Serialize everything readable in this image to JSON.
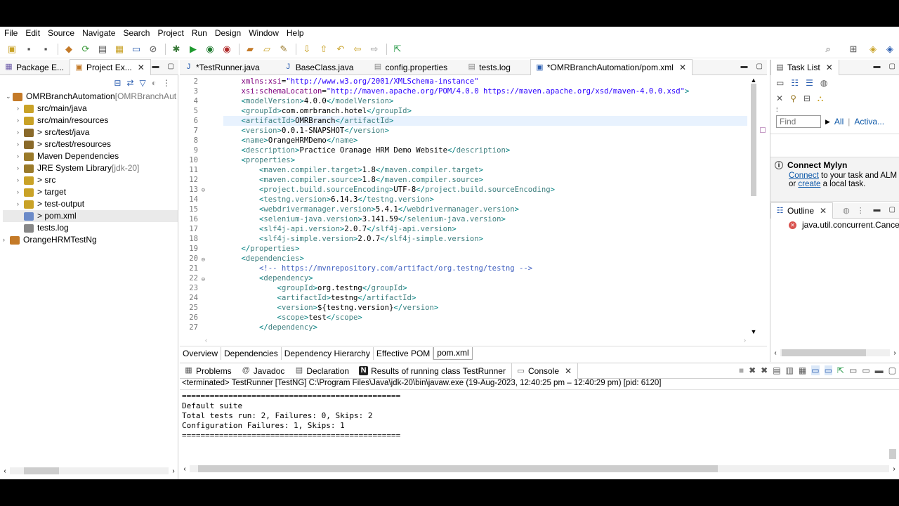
{
  "menu": [
    "File",
    "Edit",
    "Source",
    "Navigate",
    "Search",
    "Project",
    "Run",
    "Design",
    "Window",
    "Help"
  ],
  "left_panel": {
    "tabs": [
      {
        "label": "Package E..."
      },
      {
        "label": "Project Ex..."
      }
    ],
    "tree": [
      {
        "label": "OMRBranchAutomation",
        "suffix": " [OMRBranchAut",
        "depth": 0,
        "arrow": "⌄"
      },
      {
        "label": "src/main/java",
        "suffix": "",
        "depth": 1,
        "arrow": "›"
      },
      {
        "label": "src/main/resources",
        "suffix": "",
        "depth": 1,
        "arrow": "›"
      },
      {
        "label": "> src/test/java",
        "suffix": "",
        "depth": 1,
        "arrow": "›"
      },
      {
        "label": "> src/test/resources",
        "suffix": "",
        "depth": 1,
        "arrow": "›"
      },
      {
        "label": "Maven Dependencies",
        "suffix": "",
        "depth": 1,
        "arrow": "›"
      },
      {
        "label": "JRE System Library",
        "suffix": " [jdk-20]",
        "depth": 1,
        "arrow": "›"
      },
      {
        "label": "> src",
        "suffix": "",
        "depth": 1,
        "arrow": "›"
      },
      {
        "label": "> target",
        "suffix": "",
        "depth": 1,
        "arrow": "›"
      },
      {
        "label": "> test-output",
        "suffix": "",
        "depth": 1,
        "arrow": "›"
      },
      {
        "label": "> pom.xml",
        "suffix": "",
        "depth": 1,
        "arrow": ""
      },
      {
        "label": "tests.log",
        "suffix": "",
        "depth": 1,
        "arrow": ""
      },
      {
        "label": "OrangeHRMTestNg",
        "suffix": "",
        "depth": 0,
        "arrow": "›"
      }
    ]
  },
  "editor": {
    "tabs": [
      {
        "label": "*TestRunner.java"
      },
      {
        "label": "BaseClass.java"
      },
      {
        "label": "config.properties"
      },
      {
        "label": "tests.log"
      },
      {
        "label": "*OMRBranchAutomation/pom.xml"
      }
    ],
    "line_numbers": [
      "2",
      "3",
      "4",
      "5",
      "6",
      "7",
      "8",
      "9",
      "10",
      "11",
      "12",
      "13",
      "14",
      "15",
      "16",
      "17",
      "18",
      "19",
      "20",
      "21",
      "22",
      "23",
      "24",
      "25",
      "26",
      "27"
    ],
    "bottom_tabs": [
      "Overview",
      "Dependencies",
      "Dependency Hierarchy",
      "Effective POM",
      "pom.xml"
    ]
  },
  "right_panel": {
    "task_list_title": "Task List",
    "find_placeholder": "Find",
    "all_label": "All",
    "activate_label": "Activa...",
    "mylyn_title": "Connect Mylyn",
    "mylyn_connect": "Connect",
    "mylyn_text1": " to your task and ALM t",
    "mylyn_or": "or ",
    "mylyn_create": "create",
    "mylyn_text2": " a local task.",
    "outline_title": "Outline",
    "outline_item": "java.util.concurrent.Cancella"
  },
  "bottom_panel": {
    "tabs": [
      {
        "label": "Problems"
      },
      {
        "label": "Javadoc"
      },
      {
        "label": "Declaration"
      },
      {
        "label": "Results of running class TestRunner"
      },
      {
        "label": "Console"
      }
    ],
    "status_line": "<terminated> TestRunner [TestNG] C:\\Program Files\\Java\\jdk-20\\bin\\javaw.exe  (19-Aug-2023, 12:40:25 pm – 12:40:29 pm) [pid: 6120]",
    "console_lines": [
      "===============================================",
      "Default suite",
      "Total tests run: 2, Failures: 0, Skips: 2",
      "Configuration Failures: 1, Skips: 1",
      "==============================================="
    ]
  },
  "colors": {
    "tag": "#3f7f7f",
    "attr": "#7f007f",
    "value": "#2a00ff",
    "comment": "#3f5fbf",
    "link": "#0b57a8"
  }
}
